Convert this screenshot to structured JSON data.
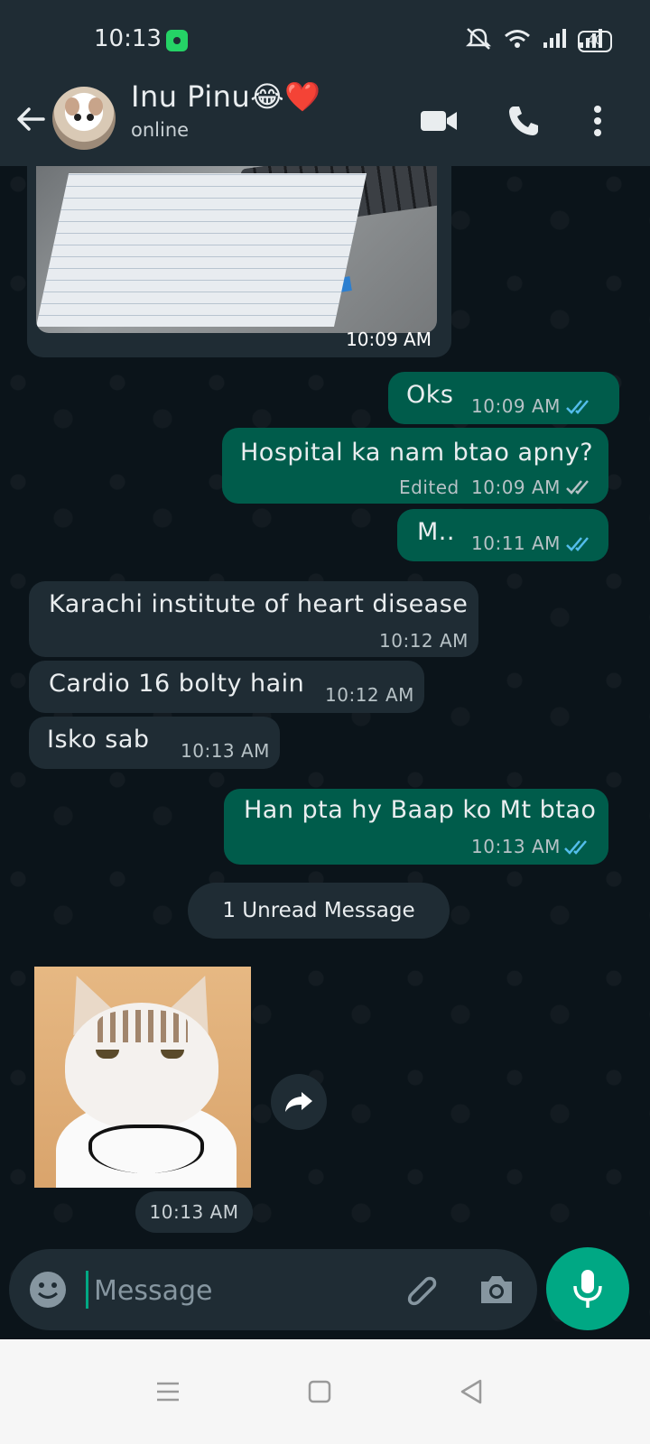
{
  "status_bar": {
    "time": "10:13",
    "battery": "40"
  },
  "header": {
    "name": "Inu Pinu😂❤️",
    "status": "online"
  },
  "image_message_1": {
    "time": "10:09 AM"
  },
  "messages": [
    {
      "dir": "out",
      "text": "Oks",
      "time": "10:09 AM",
      "edited": "",
      "read": true
    },
    {
      "dir": "out",
      "text": "Hospital ka nam btao apny?",
      "time": "10:09 AM",
      "edited": "Edited",
      "read": false
    },
    {
      "dir": "out",
      "text": "M..",
      "time": "10:11 AM",
      "edited": "",
      "read": true
    },
    {
      "dir": "in",
      "text": "Karachi institute of heart disease",
      "time": "10:12 AM"
    },
    {
      "dir": "in",
      "text": "Cardio 16 bolty hain",
      "time": "10:12 AM"
    },
    {
      "dir": "in",
      "text": "Isko sab",
      "time": "10:13 AM"
    },
    {
      "dir": "out",
      "text": "Han pta hy Baap ko Mt btao",
      "time": "10:13 AM",
      "edited": "",
      "read": true
    }
  ],
  "unread_divider": "1 Unread Message",
  "sticker_message": {
    "time": "10:13 AM"
  },
  "composer": {
    "placeholder": "Message"
  },
  "colors": {
    "outgoing": "#005c4b",
    "incoming": "#1f2c34",
    "accent": "#00a884",
    "read_tick": "#53bdeb"
  },
  "icons": [
    "back-arrow-icon",
    "video-call-icon",
    "phone-icon",
    "more-options-icon",
    "emoji-icon",
    "attach-icon",
    "camera-icon",
    "mic-icon",
    "forward-icon"
  ]
}
